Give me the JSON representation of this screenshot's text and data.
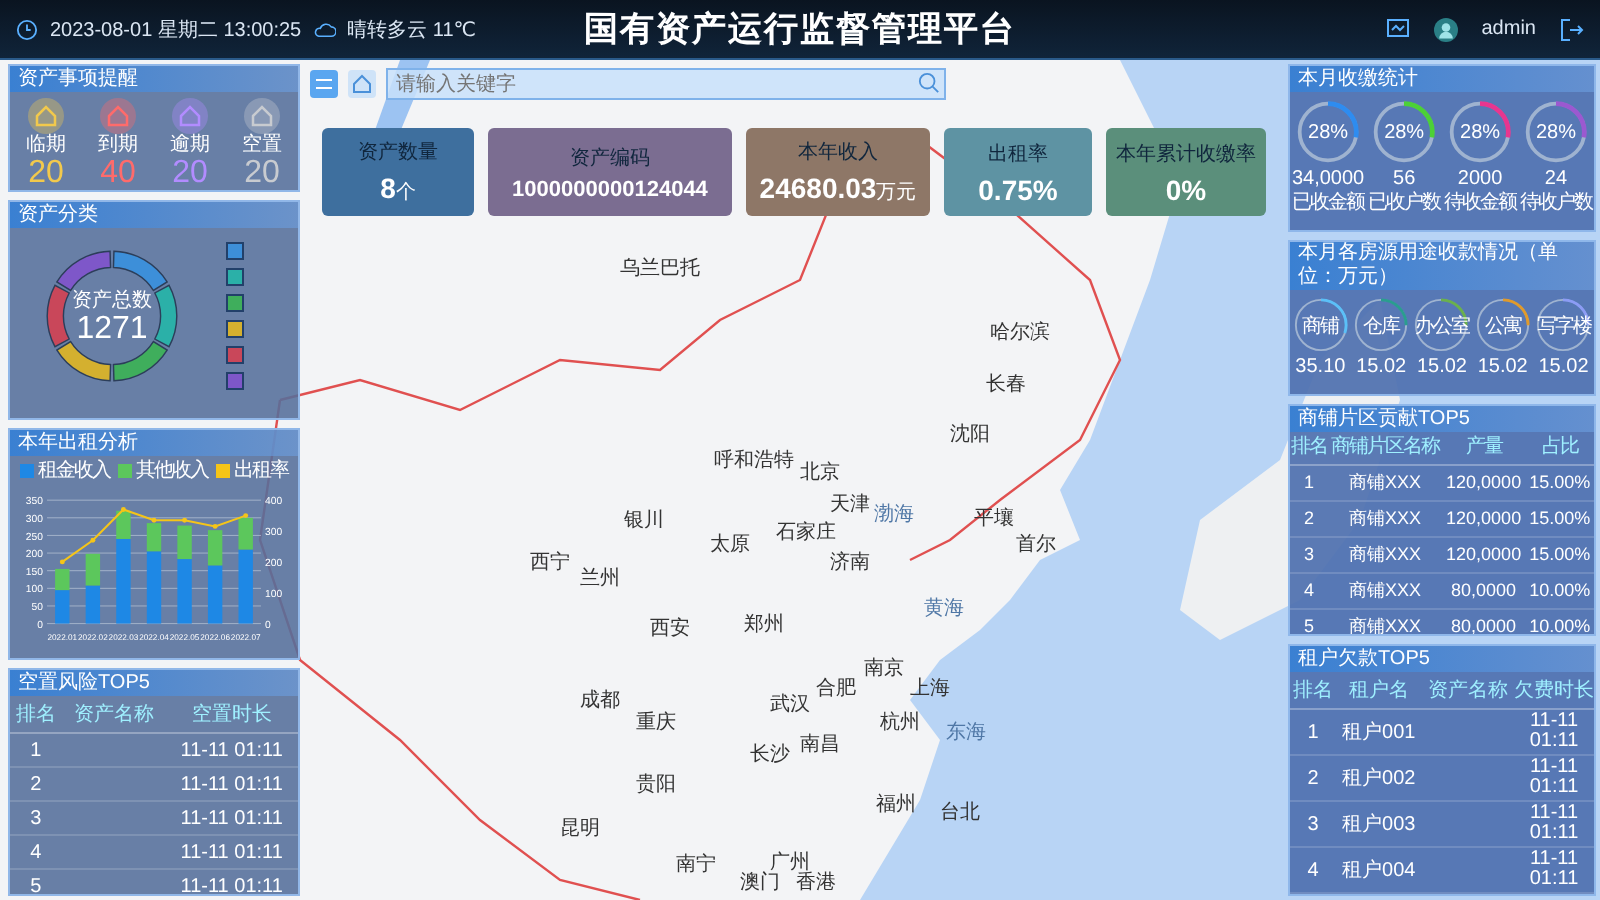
{
  "header": {
    "datetime": "2023-08-01 星期二 13:00:25",
    "weather": "晴转多云 11℃",
    "title": "国有资产运行监督管理平台",
    "user": "admin"
  },
  "reminders": {
    "title": "资产事项提醒",
    "items": [
      {
        "label": "临期",
        "count": "20",
        "color": "#f2c94c"
      },
      {
        "label": "到期",
        "count": "40",
        "color": "#ff6b6b"
      },
      {
        "label": "逾期",
        "count": "20",
        "color": "#b28cff"
      },
      {
        "label": "空置",
        "count": "20",
        "color": "#c8cbd0"
      }
    ]
  },
  "classification": {
    "title": "资产分类",
    "center_label": "资产总数",
    "total": "1271",
    "legend": [
      {
        "color": "#3d8fd9"
      },
      {
        "color": "#2bb0a8"
      },
      {
        "color": "#3fae5c"
      },
      {
        "color": "#d4b02f"
      },
      {
        "color": "#c9475a"
      },
      {
        "color": "#7e57c9"
      }
    ]
  },
  "rental": {
    "title": "本年出租分析",
    "chart_data": {
      "type": "bar",
      "stacked": true,
      "categories": [
        "2022.01",
        "2022.02",
        "2022.03",
        "2022.04",
        "2022.05",
        "2022.06",
        "2022.07"
      ],
      "series": [
        {
          "name": "租金收入",
          "color": "#1e88e5",
          "values": [
            95,
            108,
            240,
            205,
            183,
            165,
            210
          ]
        },
        {
          "name": "其他收入",
          "color": "#5cc75c",
          "values": [
            60,
            90,
            80,
            80,
            95,
            100,
            90
          ]
        }
      ],
      "ylim": [
        0,
        350
      ],
      "yticks": [
        0,
        50,
        100,
        150,
        200,
        250,
        300,
        350
      ],
      "grid": true
    },
    "rate": {
      "chart_data": {
        "type": "line",
        "series": [
          {
            "name": "出租率",
            "color": "#f5c518",
            "values": [
              200,
              270,
              370,
              335,
              335,
              315,
              350
            ]
          }
        ],
        "ylim": [
          0,
          400
        ],
        "yticks": [
          0,
          100,
          200,
          300,
          400
        ]
      }
    }
  },
  "vacancy": {
    "title": "空置风险TOP5",
    "columns": [
      "排名",
      "资产名称",
      "空置时长"
    ],
    "rows": [
      {
        "rank": "1",
        "duration": "11-11 01:11"
      },
      {
        "rank": "2",
        "duration": "11-11 01:11"
      },
      {
        "rank": "3",
        "duration": "11-11 01:11"
      },
      {
        "rank": "4",
        "duration": "11-11 01:11"
      },
      {
        "rank": "5",
        "duration": "11-11 01:11"
      }
    ]
  },
  "search": {
    "placeholder": "请输入关键字"
  },
  "cards": [
    {
      "label": "资产数量",
      "value": "8",
      "unit": "个",
      "color": "#3e6f9e"
    },
    {
      "label": "资产编码",
      "value": "1000000000124044",
      "color": "#7b6d91"
    },
    {
      "label": "本年收入",
      "value": "24680.03",
      "unit": "万元",
      "color": "#8e7767"
    },
    {
      "label": "出租率",
      "value": "0.75%",
      "color": "#5e93a3"
    },
    {
      "label": "本年累计收缴率",
      "value": "0%",
      "color": "#5b8f7b"
    }
  ],
  "map": {
    "labels": [
      "乌兰巴托",
      "哈尔滨",
      "长春",
      "沈阳",
      "呼和浩特",
      "北京",
      "天津",
      "石家庄",
      "太原",
      "济南",
      "银川",
      "西宁",
      "兰州",
      "郑州",
      "西安",
      "南京",
      "合肥",
      "上海",
      "成都",
      "武汉",
      "杭州",
      "重庆",
      "南昌",
      "长沙",
      "贵阳",
      "福州",
      "昆明",
      "广州",
      "南宁",
      "台北",
      "香港",
      "澳门",
      "平壤",
      "首尔"
    ],
    "seas": [
      "渤海",
      "黄海",
      "东海"
    ]
  },
  "collection": {
    "title": "本月收缴统计",
    "items": [
      {
        "percent": "28%",
        "level": 0.28,
        "value": "34,0000",
        "label": "已收金额",
        "color": "#2e8cf0"
      },
      {
        "percent": "28%",
        "level": 0.28,
        "value": "56",
        "label": "已收户数",
        "color": "#4cd137"
      },
      {
        "percent": "28%",
        "level": 0.28,
        "value": "2000",
        "label": "待收金额",
        "color": "#e8368f"
      },
      {
        "percent": "28%",
        "level": 0.28,
        "value": "24",
        "label": "待收户数",
        "color": "#9b59d0"
      }
    ]
  },
  "usage": {
    "title": "本月各房源用途收款情况（单位：万元）",
    "items": [
      {
        "label": "商铺",
        "value": "35.10",
        "level": 0.3,
        "color": "#5bc0f8"
      },
      {
        "label": "仓库",
        "value": "15.02",
        "level": 0.25,
        "color": "#2a9d8f"
      },
      {
        "label": "办公室",
        "value": "15.02",
        "level": 0.25,
        "color": "#6ab04c"
      },
      {
        "label": "公寓",
        "value": "15.02",
        "level": 0.25,
        "color": "#e09a2b"
      },
      {
        "label": "写字楼",
        "value": "15.02",
        "level": 0.25,
        "color": "#8c9cf5"
      }
    ]
  },
  "shops": {
    "title": "商铺片区贡献TOP5",
    "columns": [
      "排名",
      "商铺片区名称",
      "产量",
      "占比"
    ],
    "rows": [
      [
        "1",
        "商铺XXX",
        "120,0000",
        "15.00%"
      ],
      [
        "2",
        "商铺XXX",
        "120,0000",
        "15.00%"
      ],
      [
        "3",
        "商铺XXX",
        "120,0000",
        "15.00%"
      ],
      [
        "4",
        "商铺XXX",
        "80,0000",
        "10.00%"
      ],
      [
        "5",
        "商铺XXX",
        "80,0000",
        "10.00%"
      ]
    ]
  },
  "tenants": {
    "title": "租户欠款TOP5",
    "columns": [
      "排名",
      "租户名",
      "资产名称",
      "欠费时长"
    ],
    "rows": [
      {
        "rank": "1",
        "tenant": "租户001",
        "duration": "11-11 01:11"
      },
      {
        "rank": "2",
        "tenant": "租户002",
        "duration": "11-11 01:11"
      },
      {
        "rank": "3",
        "tenant": "租户003",
        "duration": "11-11 01:11"
      },
      {
        "rank": "4",
        "tenant": "租户004",
        "duration": "11-11 01:11"
      }
    ]
  }
}
